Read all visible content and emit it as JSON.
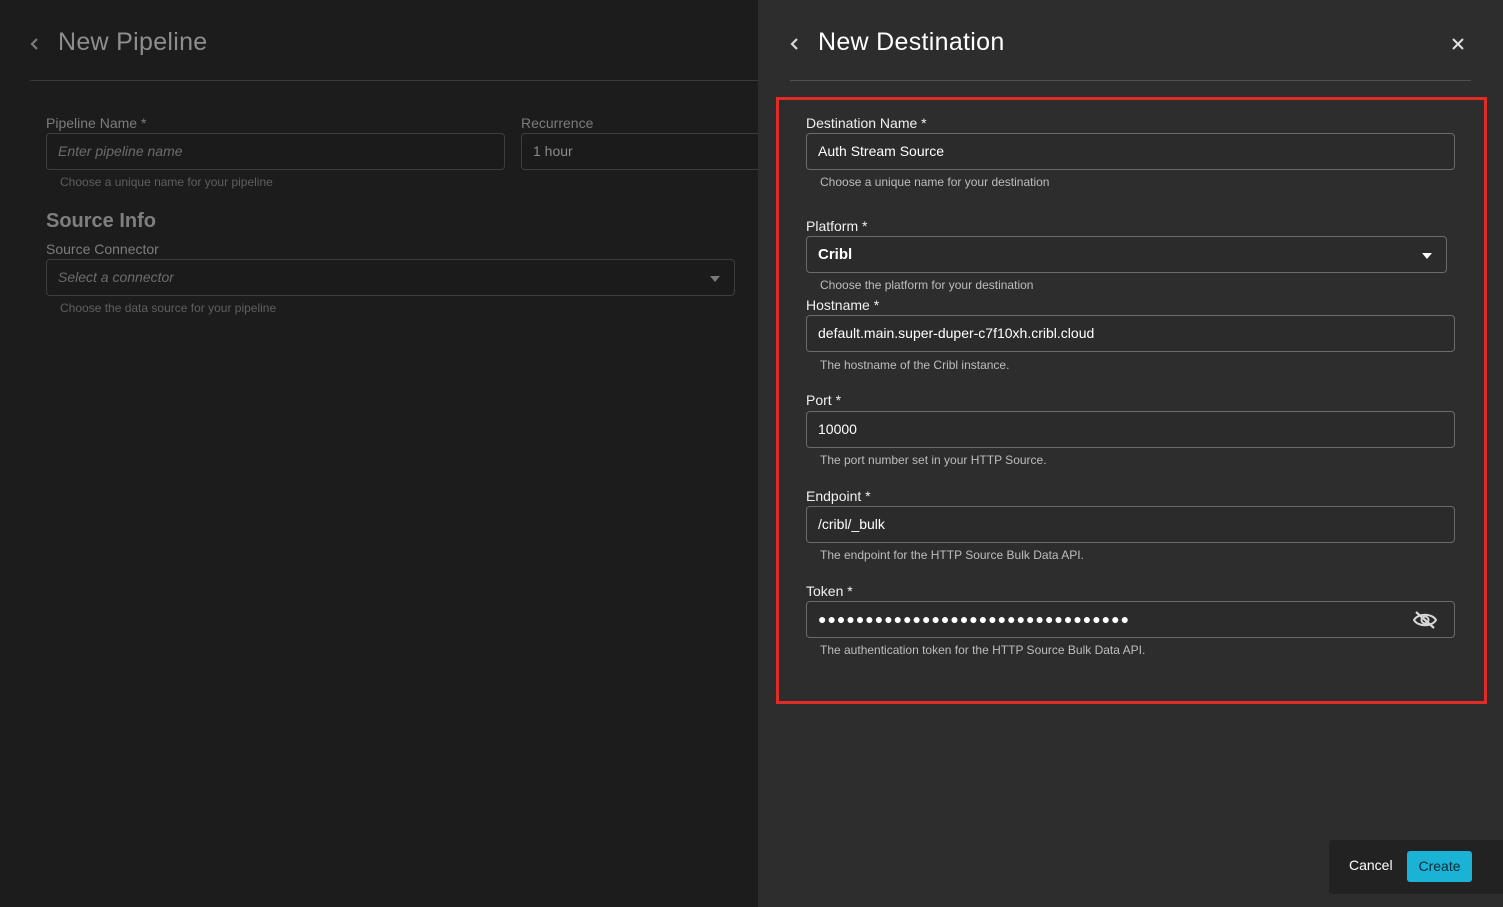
{
  "background_page": {
    "title": "New Pipeline",
    "pipeline_name": {
      "label": "Pipeline Name *",
      "placeholder": "Enter pipeline name",
      "hint": "Choose a unique name for your pipeline"
    },
    "recurrence": {
      "label": "Recurrence",
      "value": "1 hour"
    },
    "source_info": {
      "heading": "Source Info",
      "label": "Source Connector",
      "placeholder": "Select a connector",
      "hint": "Choose the data source for your pipeline"
    }
  },
  "drawer": {
    "title": "New Destination",
    "fields": {
      "destination_name": {
        "label": "Destination Name *",
        "value": "Auth Stream Source",
        "hint": "Choose a unique name for your destination"
      },
      "platform": {
        "label": "Platform *",
        "value": "Cribl",
        "hint": "Choose the platform for your destination"
      },
      "hostname": {
        "label": "Hostname *",
        "value": "default.main.super-duper-c7f10xh.cribl.cloud",
        "hint": "The hostname of the Cribl instance."
      },
      "port": {
        "label": "Port *",
        "value": "10000",
        "hint": "The port number set in your HTTP Source."
      },
      "endpoint": {
        "label": "Endpoint *",
        "value": "/cribl/_bulk",
        "hint": "The endpoint for the HTTP Source Bulk Data API."
      },
      "token": {
        "label": "Token *",
        "value": "●●●●●●●●●●●●●●●●●●●●●●●●●●●●●●●●●",
        "hint": "The authentication token for the HTTP Source Bulk Data API."
      }
    },
    "footer": {
      "cancel_label": "Cancel",
      "create_label": "Create"
    }
  },
  "colors": {
    "accent": "#1ab3d6",
    "highlight": "#e02b27",
    "drawer_bg": "#2d2d2d",
    "page_bg": "#1c1c1c"
  },
  "icons": [
    "chevron-left-icon",
    "close-icon",
    "caret-down-icon",
    "eye-off-icon"
  ]
}
